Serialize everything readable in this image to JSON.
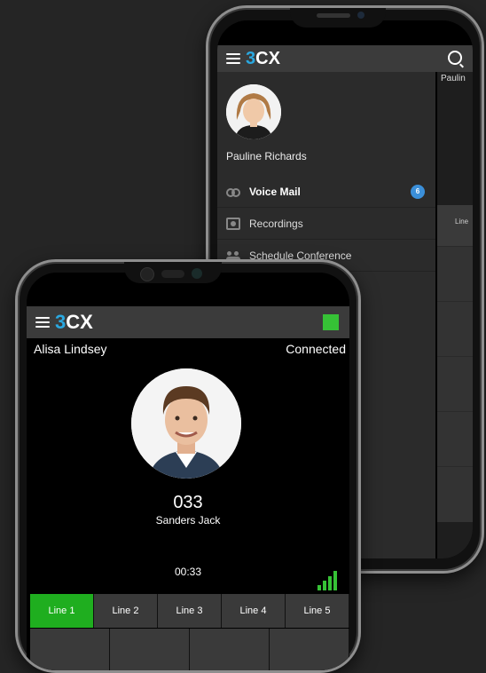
{
  "back_phone": {
    "logo": {
      "three": "3",
      "cx": "CX"
    },
    "search_icon": "search-icon",
    "peek_name": "Paulin",
    "peek_line_label": "Line",
    "drawer": {
      "user_name": "Pauline Richards",
      "items": [
        {
          "label": "Voice Mail",
          "icon": "voicemail-icon",
          "badge": "6",
          "active": true
        },
        {
          "label": "Recordings",
          "icon": "recordings-icon"
        },
        {
          "label": "Schedule Conference",
          "icon": "conference-icon"
        }
      ]
    }
  },
  "front_phone": {
    "logo": {
      "three": "3",
      "cx": "CX"
    },
    "status_color": "#36c236",
    "caller_left": "Alisa Lindsey",
    "status_text": "Connected",
    "call": {
      "number": "033",
      "name": "Sanders Jack",
      "timer": "00:33"
    },
    "lines": [
      "Line 1",
      "Line 2",
      "Line 3",
      "Line 4",
      "Line 5"
    ],
    "active_line": "Line 1"
  },
  "colors": {
    "accent": "#2aa8e0",
    "active_green": "#1fae1f",
    "badge_blue": "#3b8fd9"
  }
}
